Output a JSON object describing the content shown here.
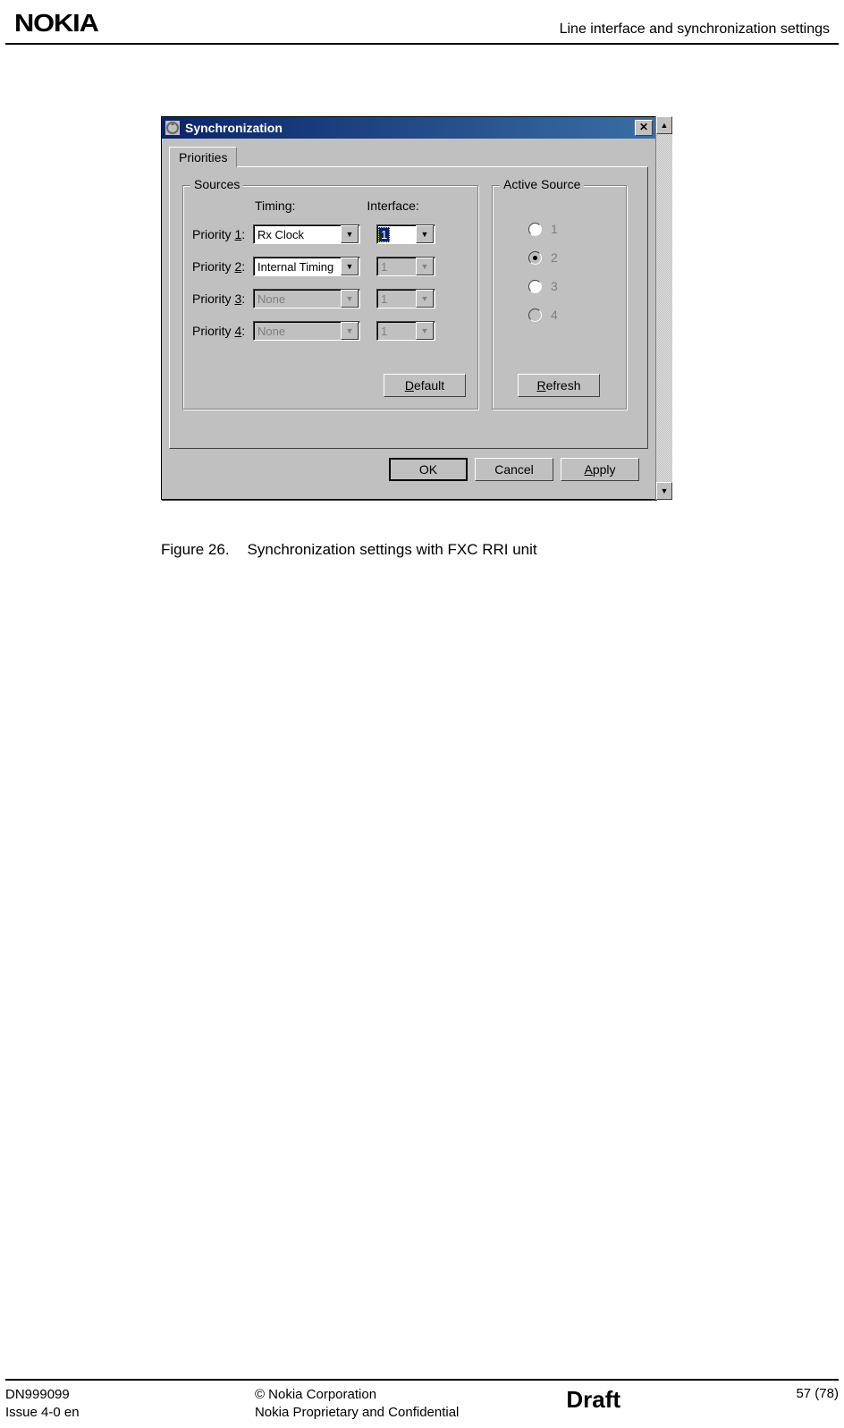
{
  "header": {
    "logo": "NOKIA",
    "section": "Line interface and synchronization settings"
  },
  "dialog": {
    "title": "Synchronization",
    "tab": "Priorities",
    "sources_legend": "Sources",
    "active_legend": "Active Source",
    "col_timing": "Timing:",
    "col_interface": "Interface:",
    "rows": [
      {
        "label_pre": "Priority ",
        "num": "1",
        "label_post": ":",
        "timing": "Rx Clock",
        "iface": "1",
        "t_enabled": true,
        "i_enabled": true,
        "i_selected": true
      },
      {
        "label_pre": "Priority ",
        "num": "2",
        "label_post": ":",
        "timing": "Internal Timing",
        "iface": "1",
        "t_enabled": true,
        "i_enabled": false,
        "i_selected": false
      },
      {
        "label_pre": "Priority ",
        "num": "3",
        "label_post": ":",
        "timing": "None",
        "iface": "1",
        "t_enabled": false,
        "i_enabled": false,
        "i_selected": false
      },
      {
        "label_pre": "Priority ",
        "num": "4",
        "label_post": ":",
        "timing": "None",
        "iface": "1",
        "t_enabled": false,
        "i_enabled": false,
        "i_selected": false
      }
    ],
    "active": [
      "1",
      "2",
      "3",
      "4"
    ],
    "btn_default_pre": "",
    "btn_default_ul": "D",
    "btn_default_post": "efault",
    "btn_refresh_pre": "",
    "btn_refresh_ul": "R",
    "btn_refresh_post": "efresh",
    "btn_ok": "OK",
    "btn_cancel": "Cancel",
    "btn_apply_pre": "",
    "btn_apply_ul": "A",
    "btn_apply_post": "pply"
  },
  "caption": {
    "label": "Figure 26.",
    "text": "Synchronization settings with FXC RRI unit"
  },
  "footer": {
    "doc": "DN999099",
    "issue": "Issue 4-0 en",
    "corp": "© Nokia Corporation",
    "conf": "Nokia Proprietary and Confidential",
    "draft": "Draft",
    "page": "57 (78)"
  }
}
